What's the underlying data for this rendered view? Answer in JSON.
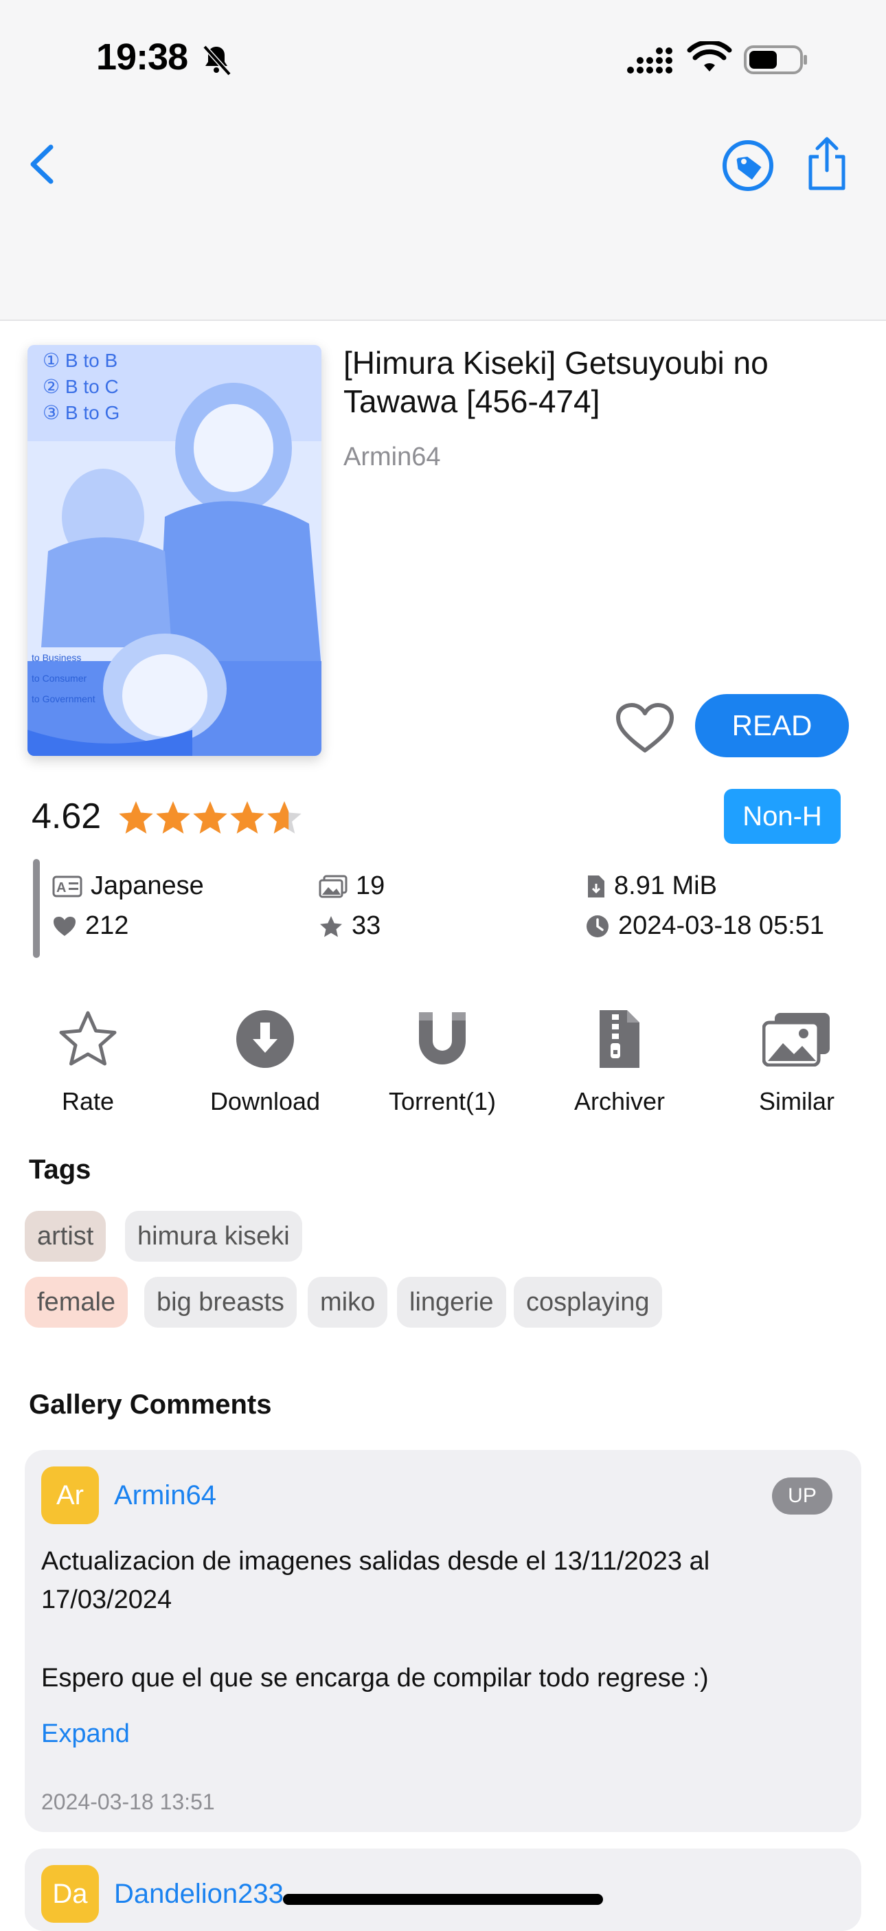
{
  "status_bar": {
    "time": "19:38"
  },
  "gallery": {
    "title": "[Himura Kiseki] Getsuyoubi no Tawawa [456-474]",
    "uploader": "Armin64",
    "read_label": "READ",
    "rating": "4.62",
    "rating_value": 4.62,
    "rating_max": 5,
    "category": "Non-H",
    "category_color": "#1fa0ff",
    "accent_color": "#1a82f0"
  },
  "meta": {
    "language": "Japanese",
    "pages": "19",
    "size": "8.91 MiB",
    "favorites": "212",
    "rating_count": "33",
    "posted": "2024-03-18 05:51"
  },
  "actions": [
    {
      "label": "Rate",
      "icon": "star-outline-icon"
    },
    {
      "label": "Download",
      "icon": "download-circle-icon"
    },
    {
      "label": "Torrent(1)",
      "icon": "magnet-icon"
    },
    {
      "label": "Archiver",
      "icon": "archive-file-icon"
    },
    {
      "label": "Similar",
      "icon": "photo-stack-icon"
    }
  ],
  "tags": {
    "heading": "Tags",
    "groups": [
      {
        "namespace": "artist",
        "color": "#e7dbd6",
        "values": [
          "himura kiseki"
        ]
      },
      {
        "namespace": "female",
        "color": "#fbdcd3",
        "values": [
          "big breasts",
          "miko",
          "lingerie",
          "cosplaying"
        ]
      }
    ]
  },
  "comments": {
    "heading": "Gallery Comments",
    "items": [
      {
        "avatar": "Ar",
        "author": "Armin64",
        "badge": "UP",
        "line1": "Actualizacion de imagenes salidas desde el 13/11/2023 al",
        "line2": "17/03/2024",
        "line3": "Espero que el que se encarga de compilar todo regrese :)",
        "expand": "Expand",
        "date": "2024-03-18 13:51"
      },
      {
        "avatar": "Da",
        "author": "Dandelion233"
      }
    ]
  }
}
